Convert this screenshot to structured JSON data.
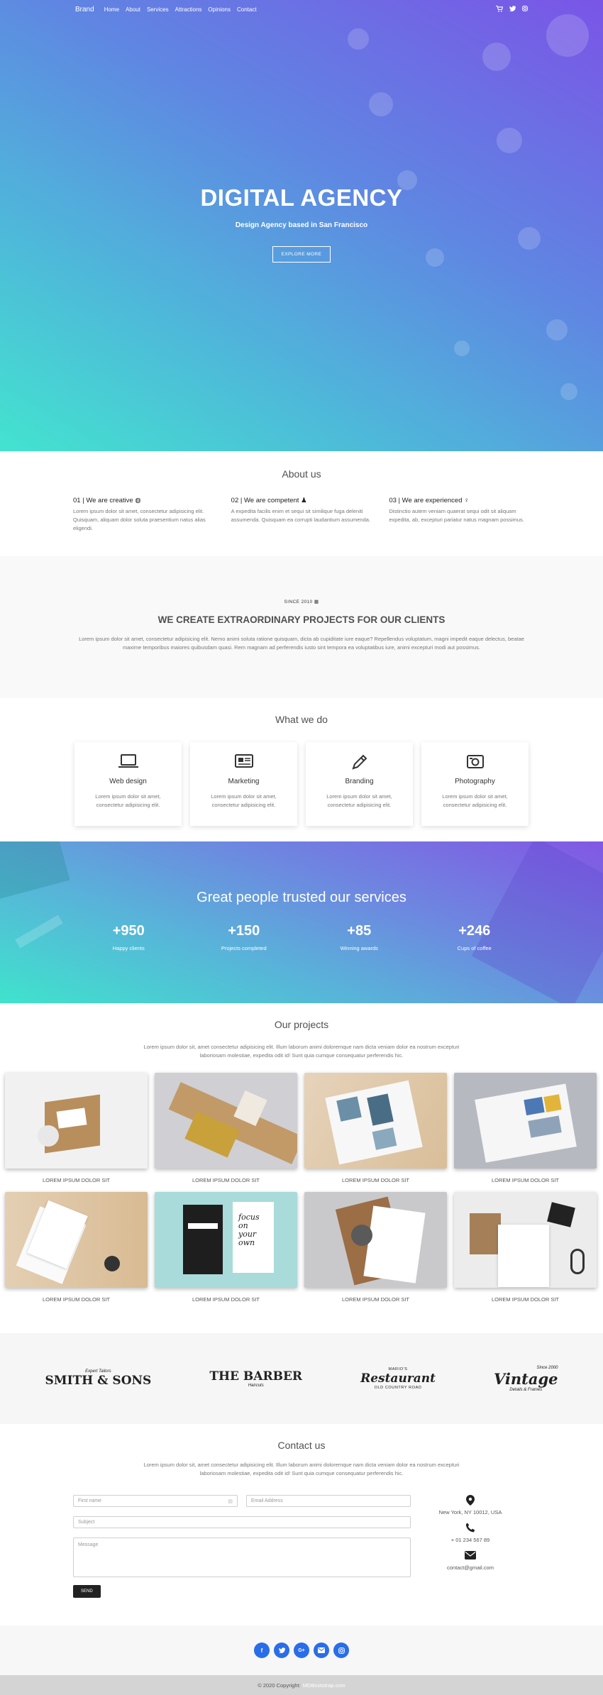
{
  "nav": {
    "brand": "Brand",
    "links": [
      "Home",
      "About",
      "Services",
      "Attractions",
      "Opinions",
      "Contact"
    ],
    "icons": [
      "cart-icon",
      "twitter-icon",
      "instagram-icon"
    ]
  },
  "hero": {
    "title": "DIGITAL AGENCY",
    "subtitle": "Design Agency based in San Francisco",
    "button": "EXPLORE MORE"
  },
  "about": {
    "title": "About us",
    "items": [
      {
        "heading": "01 | We are creative",
        "icon": "globe-icon",
        "text": "Lorem ipsum dolor sit amet, consectetur adipisicing elit. Quisquam, aliquam dolor soluta praesentium natus alias eligendi."
      },
      {
        "heading": "02 | We are competent",
        "icon": "people-icon",
        "text": "A expedita facilis enim et sequi sit similique fuga deleniti assumenda. Quisquam ea corrupti laudantium assumenda."
      },
      {
        "heading": "03 | We are experienced",
        "icon": "bulb-icon",
        "text": "Distinctio autem veniam quaerat sequi odit sit aliquam expedita, ab, excepturi pariatur natus magnam possimus."
      }
    ]
  },
  "since": {
    "small": "SINCE 2010",
    "title": "WE CREATE EXTRAORDINARY PROJECTS FOR OUR CLIENTS",
    "text": "Lorem ipsum dolor sit amet, consectetur adipisicing elit. Nemo animi soluta ratione quisquam, dicta ab cupiditate iure eaque? Repellendus voluptatum, magni impedit eaque delectus, beatae maxime temporibus maiores quibusdam quasi. Rem magnam ad perferendis iusto sint tempora ea voluptatibus iure, animi excepturi modi aut possimus."
  },
  "services": {
    "title": "What we do",
    "items": [
      {
        "name": "Web design",
        "icon": "laptop-icon",
        "text": "Lorem ipsum dolor sit amet, consectetur adipisicing elit."
      },
      {
        "name": "Marketing",
        "icon": "newspaper-icon",
        "text": "Lorem ipsum dolor sit amet, consectetur adipisicing elit."
      },
      {
        "name": "Branding",
        "icon": "pencil-icon",
        "text": "Lorem ipsum dolor sit amet, consectetur adipisicing elit."
      },
      {
        "name": "Photography",
        "icon": "camera-icon",
        "text": "Lorem ipsum dolor sit amet, consectetur adipisicing elit."
      }
    ]
  },
  "stats": {
    "title": "Great people trusted our services",
    "items": [
      {
        "number": "+950",
        "label": "Happy clients"
      },
      {
        "number": "+150",
        "label": "Projects completed"
      },
      {
        "number": "+85",
        "label": "Winning awards"
      },
      {
        "number": "+246",
        "label": "Cups of coffee"
      }
    ]
  },
  "projects": {
    "title": "Our projects",
    "intro": "Lorem ipsum dolor sit, amet consectetur adipisicing elit. Illum laborum animi doloremque nam dicta veniam dolor ea nostrum excepturi laboriosam molestiae, expedita odit id! Sunt quia cumque consequatur perferendis hic.",
    "items": [
      {
        "caption": "LOREM IPSUM DOLOR SIT"
      },
      {
        "caption": "LOREM IPSUM DOLOR SIT"
      },
      {
        "caption": "LOREM IPSUM DOLOR SIT"
      },
      {
        "caption": "LOREM IPSUM DOLOR SIT"
      },
      {
        "caption": "LOREM IPSUM DOLOR SIT"
      },
      {
        "caption": "LOREM IPSUM DOLOR SIT"
      },
      {
        "caption": "LOREM IPSUM DOLOR SIT"
      },
      {
        "caption": "LOREM IPSUM DOLOR SIT"
      }
    ]
  },
  "brands": [
    {
      "small": "Expert Tailors",
      "big": "SMITH & SONS",
      "under": ""
    },
    {
      "small": "",
      "big": "THE BARBER",
      "under": "Haircuts"
    },
    {
      "small": "MARIO'S",
      "big": "Restaurant",
      "under": "OLD COUNTRY ROAD"
    },
    {
      "small": "Since 2000",
      "big": "Vintage",
      "under": "Details & Frames"
    }
  ],
  "contact": {
    "title": "Contact us",
    "intro": "Lorem ipsum dolor sit, amet consectetur adipisicing elit. Illum laborum animi doloremque nam dicta veniam dolor ea nostrum excepturi laboriosam molestiae, expedita odit id! Sunt quia cumque consequatur perferendis hic.",
    "first_name_placeholder": "First name",
    "email_placeholder": "Email Address",
    "subject_placeholder": "Subject",
    "message_placeholder": "Message",
    "send": "SEND",
    "address": "New York, NY 10012, USA",
    "phone": "+ 01 234 567 89",
    "email": "contact@gmail.com"
  },
  "social": [
    "facebook-icon",
    "twitter-icon",
    "google-plus-icon",
    "email-icon",
    "instagram-icon"
  ],
  "footer": {
    "copyright": "© 2020 Copyright:",
    "link": "MDBootstrap.com"
  },
  "colors": {
    "accent": "#2a6de8",
    "hero_start": "#43e3cf",
    "hero_end": "#7a55e6",
    "dark_button": "#222222"
  }
}
